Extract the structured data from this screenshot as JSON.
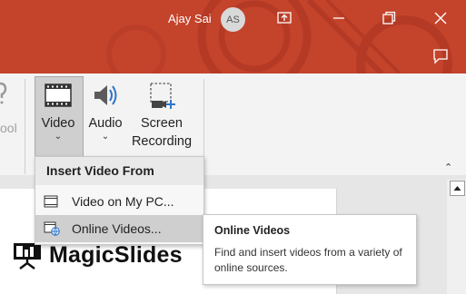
{
  "titlebar": {
    "user_name": "Ajay Sai",
    "avatar_initials": "AS",
    "accent_color": "#c4432b",
    "buttons": [
      "present-icon",
      "minimize-icon",
      "restore-icon",
      "close-icon",
      "comment-icon"
    ]
  },
  "ribbon": {
    "partial_left_label": "ool",
    "video_label": "Video",
    "audio_label": "Audio",
    "screen_recording_line1": "Screen",
    "screen_recording_line2": "Recording",
    "caret": "⌄",
    "collapse": "⌃"
  },
  "menu": {
    "header": "Insert Video From",
    "items": [
      {
        "label": "Video on My PC...",
        "icon": "film-strip-icon"
      },
      {
        "label": "Online Videos...",
        "icon": "online-video-icon",
        "hovered": true
      }
    ]
  },
  "tooltip": {
    "title": "Online Videos",
    "body": "Find and insert videos from a variety of online sources."
  },
  "slide": {
    "logo_text": "MagicSlides"
  }
}
